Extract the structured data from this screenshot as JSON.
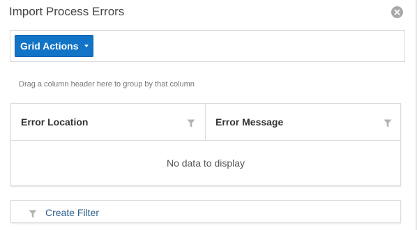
{
  "dialog": {
    "title": "Import Process Errors",
    "close_icon": "close-circle-icon"
  },
  "toolbar": {
    "grid_actions_label": "Grid Actions",
    "accent_color": "#1274c6"
  },
  "group_hint": "Drag a column header here to group by that column",
  "grid": {
    "columns": [
      {
        "label": "Error Location",
        "icon": "filter-icon"
      },
      {
        "label": "Error Message",
        "icon": "filter-icon"
      }
    ],
    "empty_message": "No data to display"
  },
  "filter_bar": {
    "label": "Create Filter",
    "icon": "filter-icon"
  }
}
